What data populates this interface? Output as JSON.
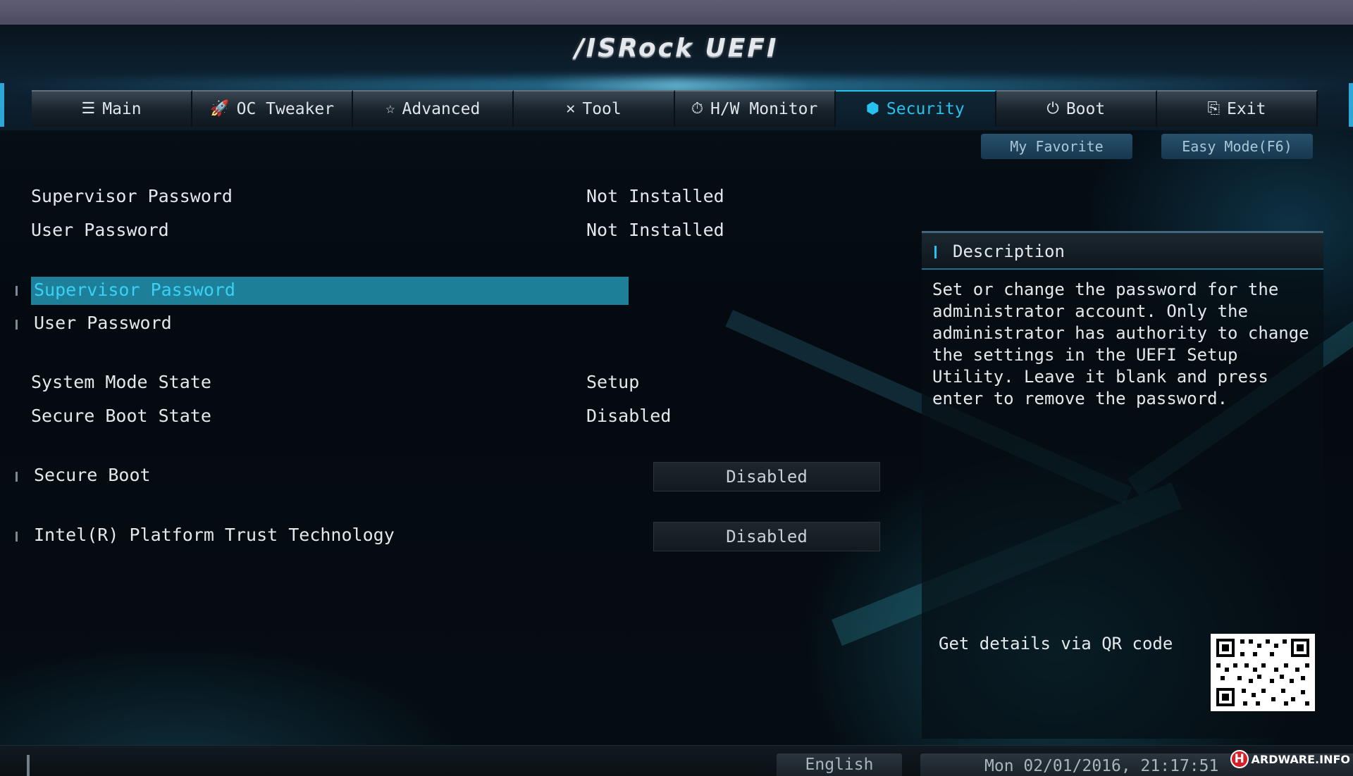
{
  "app": {
    "logo_text": "/ISRock UEFI"
  },
  "nav": {
    "tabs": [
      {
        "label": "Main",
        "icon": "list-icon",
        "glyph": "☰"
      },
      {
        "label": "OC Tweaker",
        "icon": "rocket-icon",
        "glyph": "🚀"
      },
      {
        "label": "Advanced",
        "icon": "star-icon",
        "glyph": "☆"
      },
      {
        "label": "Tool",
        "icon": "tools-icon",
        "glyph": "✕"
      },
      {
        "label": "H/W Monitor",
        "icon": "monitor-icon",
        "glyph": "⏱"
      },
      {
        "label": "Security",
        "icon": "shield-icon",
        "glyph": "⬢"
      },
      {
        "label": "Boot",
        "icon": "power-icon",
        "glyph": "⏻"
      },
      {
        "label": "Exit",
        "icon": "exit-icon",
        "glyph": "⎘"
      }
    ],
    "active_tab": "Security"
  },
  "subbuttons": {
    "favorite": "My Favorite",
    "easy_mode": "Easy Mode(F6)"
  },
  "settings": {
    "supervisor_password_label": "Supervisor Password",
    "supervisor_password_value": "Not Installed",
    "user_password_label": "User Password",
    "user_password_value": "Not Installed",
    "supervisor_password_item": "Supervisor Password",
    "user_password_item": "User Password",
    "system_mode_label": "System Mode State",
    "system_mode_value": "Setup",
    "secure_boot_state_label": "Secure Boot State",
    "secure_boot_state_value": "Disabled",
    "secure_boot_label": "Secure Boot",
    "secure_boot_value": "Disabled",
    "ptt_label": "Intel(R) Platform Trust Technology",
    "ptt_value": "Disabled"
  },
  "description": {
    "title": "Description",
    "text": "Set or change the password for the administrator account. Only the administrator has authority to change the settings in the UEFI Setup Utility. Leave it blank and press enter to remove the password.",
    "qr_label": "Get details via QR code"
  },
  "status": {
    "language": "English",
    "datetime": "Mon 02/01/2016, 21:17:51"
  },
  "watermark": {
    "letter": "H",
    "text": "ARDWARE.INFO"
  },
  "colors": {
    "accent": "#27c2ee",
    "selected_bg": "#1e7f99",
    "text": "#e3e8ec"
  }
}
